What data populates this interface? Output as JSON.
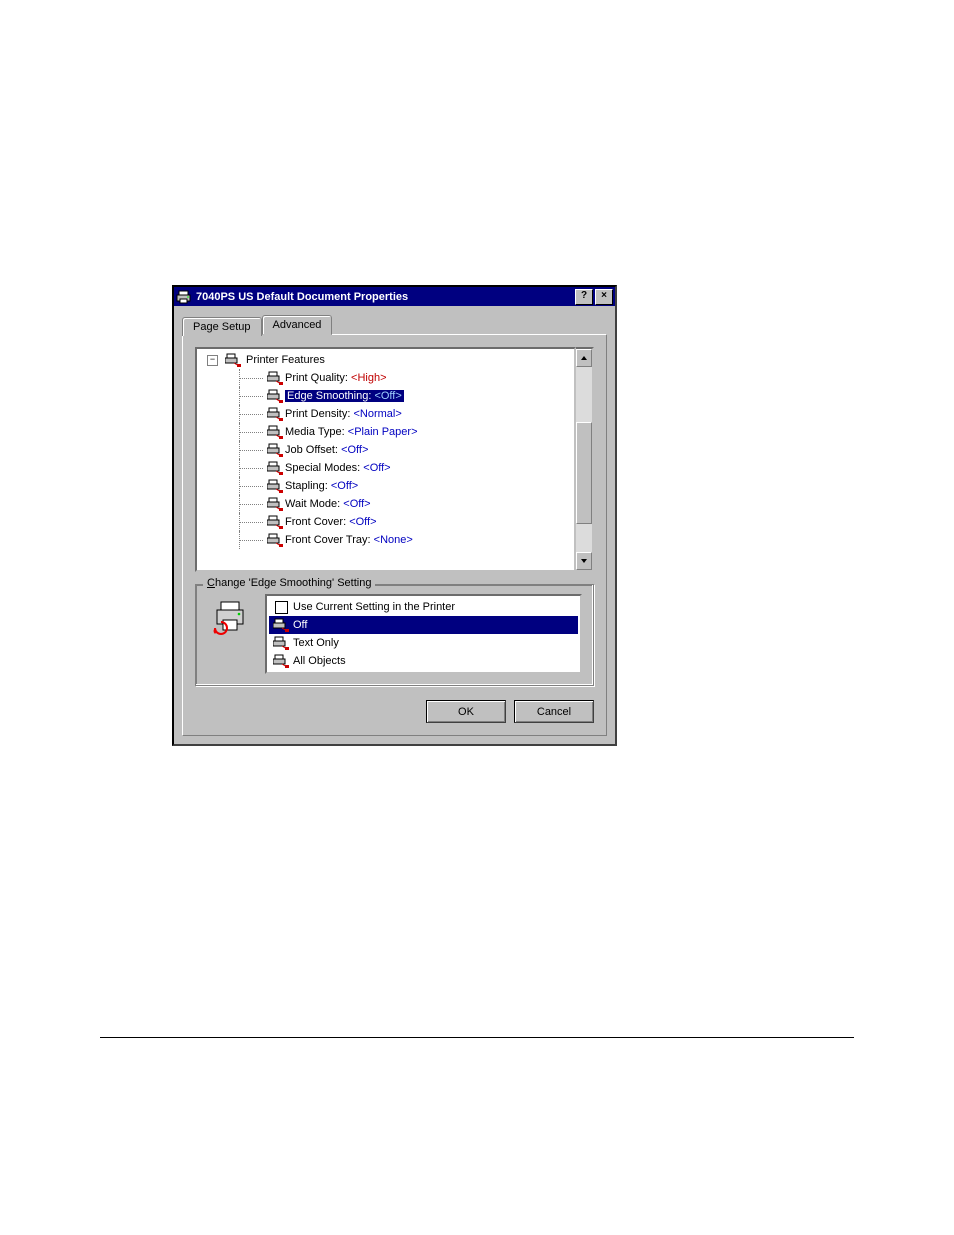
{
  "dialog": {
    "title": "7040PS US Default Document Properties",
    "help_btn": "?",
    "close_btn": "×"
  },
  "tabs": {
    "page_setup": "Page Setup",
    "advanced": "Advanced"
  },
  "tree": {
    "expander": "−",
    "root_label": "Printer Features",
    "items": [
      {
        "label": "Print Quality: ",
        "value": "<High>",
        "value_class": "val-red",
        "selected": false
      },
      {
        "label": "Edge Smoothing: ",
        "value": "<Off>",
        "value_class": "val-blue",
        "selected": true
      },
      {
        "label": "Print Density: ",
        "value": "<Normal>",
        "value_class": "val-blue",
        "selected": false
      },
      {
        "label": "Media Type: ",
        "value": "<Plain Paper>",
        "value_class": "val-blue",
        "selected": false
      },
      {
        "label": "Job Offset: ",
        "value": "<Off>",
        "value_class": "val-blue",
        "selected": false
      },
      {
        "label": "Special Modes: ",
        "value": "<Off>",
        "value_class": "val-blue",
        "selected": false
      },
      {
        "label": "Stapling: ",
        "value": "<Off>",
        "value_class": "val-blue",
        "selected": false
      },
      {
        "label": "Wait Mode: ",
        "value": "<Off>",
        "value_class": "val-blue",
        "selected": false
      },
      {
        "label": "Front Cover: ",
        "value": "<Off>",
        "value_class": "val-blue",
        "selected": false
      },
      {
        "label": "Front Cover Tray: ",
        "value": "<None>",
        "value_class": "val-blue",
        "selected": false
      }
    ]
  },
  "setting_group": {
    "legend": "Change 'Edge Smoothing' Setting",
    "options": [
      {
        "label": "Use Current Setting in the Printer",
        "icon": "checkbox-empty-icon",
        "selected": false
      },
      {
        "label": "Off",
        "icon": "feature-icon",
        "selected": true
      },
      {
        "label": "Text Only",
        "icon": "feature-icon",
        "selected": false
      },
      {
        "label": "All Objects",
        "icon": "feature-icon",
        "selected": false
      }
    ]
  },
  "buttons": {
    "ok": "OK",
    "cancel": "Cancel"
  },
  "icons": {
    "printer_small": "printer-icon",
    "feature": "feature-icon",
    "printer_large": "printer-large-icon"
  }
}
